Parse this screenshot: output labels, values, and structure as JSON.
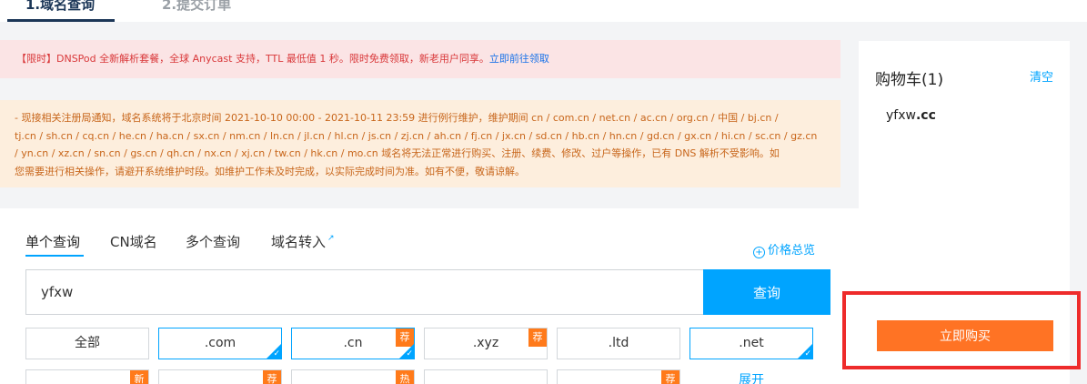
{
  "steps": {
    "step1": "1.域名查询",
    "step2": "2.提交订单"
  },
  "notices": {
    "red_text": "【限时】DNSPod 全新解析套餐，全球 Anycast 支持，TTL 最低值 1 秒。限时免费领取，新老用户同享。",
    "red_link": "立即前往领取",
    "orange_lines": [
      "- 现接相关注册局通知，域名系统将于北京时间 2021-10-10 00:00 - 2021-10-11 23:59 进行例行维护，维护期间 cn / com.cn / net.cn / ac.cn / org.cn / 中国 / bj.cn /",
      "tj.cn / sh.cn / cq.cn / he.cn / ha.cn / sx.cn / nm.cn / ln.cn / jl.cn / hl.cn / js.cn / zj.cn / ah.cn / fj.cn / jx.cn / sd.cn / hb.cn / hn.cn / gd.cn / gx.cn / hi.cn / sc.cn / gz.cn",
      "/ yn.cn / xz.cn / sn.cn / gs.cn / qh.cn / nx.cn / xj.cn / tw.cn / hk.cn / mo.cn 域名将无法正常进行购买、注册、续费、修改、过户等操作，已有 DNS 解析不受影响。如",
      "您需要进行相关操作，请避开系统维护时段。如维护工作未及时完成，以实际完成时间为准。如有不便，敬请谅解。"
    ]
  },
  "search": {
    "tabs": [
      "单个查询",
      "CN域名",
      "多个查询",
      "域名转入"
    ],
    "price_overview": "价格总览",
    "input_value": "yfxw",
    "button_label": "查询"
  },
  "suffixes": {
    "row1": [
      {
        "label": "全部",
        "selected": false,
        "badge": ""
      },
      {
        "label": ".com",
        "selected": true,
        "badge": ""
      },
      {
        "label": ".cn",
        "selected": true,
        "badge": "荐"
      },
      {
        "label": ".xyz",
        "selected": false,
        "badge": "荐"
      },
      {
        "label": ".ltd",
        "selected": false,
        "badge": ""
      },
      {
        "label": ".net",
        "selected": true,
        "badge": ""
      }
    ],
    "row2_badges": [
      "新",
      "荐",
      "热",
      "",
      "荐"
    ],
    "row2_expand": "展开"
  },
  "cart": {
    "title": "购物车(1)",
    "clear": "清空",
    "item_name": "yfxw",
    "item_suffix": ".cc",
    "buy_button": "立即购买"
  },
  "colors": {
    "accent": "#00a4ff",
    "buy": "#ff7324",
    "badge": "#ff7a1a",
    "highlight": "#ee2b2b"
  }
}
